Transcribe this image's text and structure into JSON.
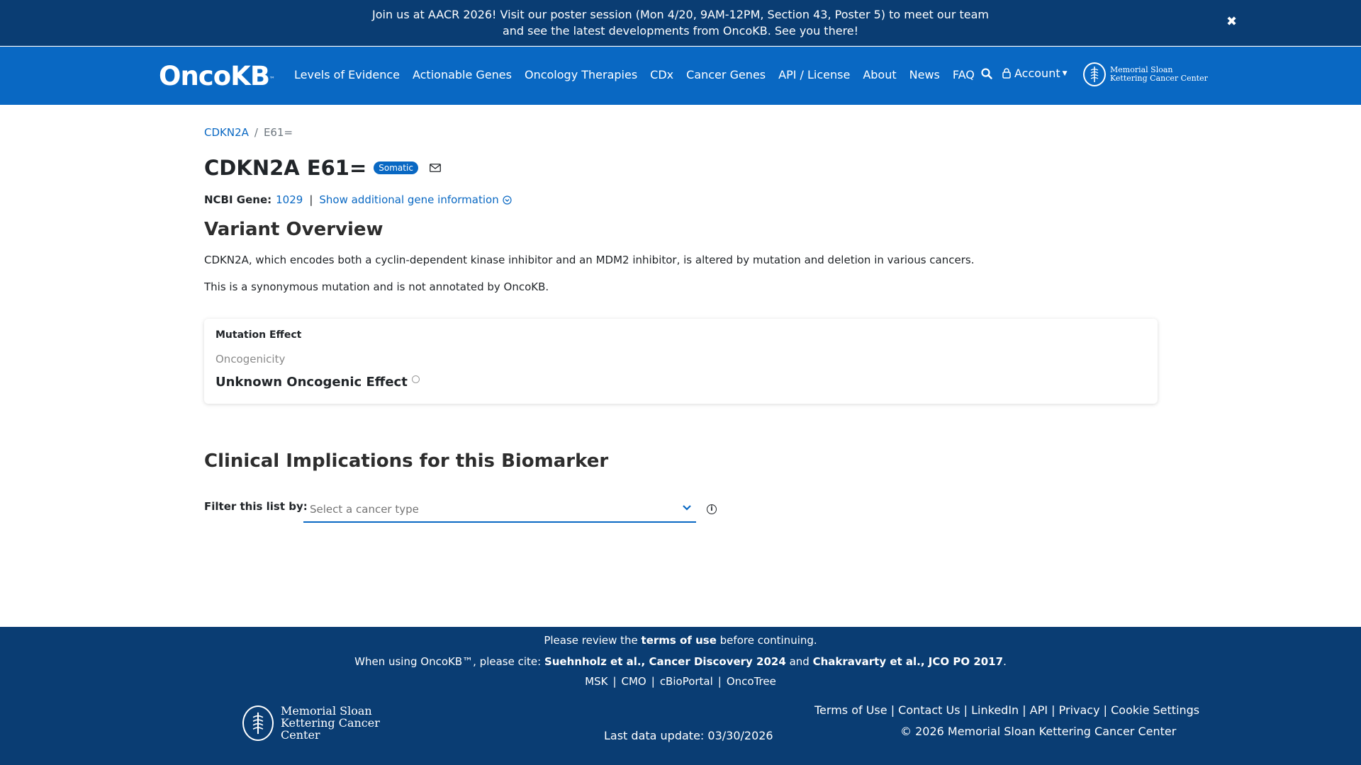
{
  "banner": {
    "text": "Join us at AACR 2026! Visit our poster session (Mon 4/20, 9AM-12PM, Section 43, Poster 5) to meet our team and see the latest developments from OncoKB. See you there!",
    "close": "✖"
  },
  "nav": {
    "logo": "OncoKB",
    "logo_tm": "™",
    "links": [
      "Levels of Evidence",
      "Actionable Genes",
      "Oncology Therapies",
      "CDx",
      "Cancer Genes",
      "API / License",
      "About",
      "News",
      "FAQ"
    ],
    "account": "Account",
    "msk_logo": "Memorial Sloan Kettering Cancer Center"
  },
  "breadcrumb": {
    "gene": "CDKN2A",
    "variant": "E61="
  },
  "header": {
    "title": "CDKN2A E61=",
    "badge": "Somatic"
  },
  "gene_info": {
    "label": "NCBI Gene:",
    "id": "1029",
    "toggle": "Show additional gene information"
  },
  "overview": {
    "heading": "Variant Overview",
    "paragraph1": "CDKN2A, which encodes both a cyclin-dependent kinase inhibitor and an MDM2 inhibitor, is altered by mutation and deletion in various cancers.",
    "paragraph2": "This is a synonymous mutation and is not annotated by OncoKB."
  },
  "mutation_card": {
    "title": "Mutation Effect",
    "subtitle": "Oncogenicity",
    "value": "Unknown Oncogenic Effect"
  },
  "clinical": {
    "heading": "Clinical Implications for this Biomarker",
    "filter_label": "Filter this list by:",
    "select_placeholder": "Select a cancer type"
  },
  "footer": {
    "terms_pre": "Please review the ",
    "terms_link": "terms of use",
    "terms_post": " before continuing.",
    "cite_pre": "When using OncoKB™, please cite: ",
    "cite1": "Suehnholz et al., Cancer Discovery 2024",
    "cite_and": " and ",
    "cite2": "Chakravarty et al., JCO PO 2017",
    "cite_end": ".",
    "links": [
      "MSK",
      "CMO",
      "cBioPortal",
      "OncoTree"
    ],
    "msk_logo": "Memorial Sloan Kettering Cancer Center",
    "last_update": "Last data update: 03/30/2026",
    "right_links": [
      "Terms of Use",
      "Contact Us",
      "LinkedIn",
      "API",
      "Privacy",
      "Cookie Settings"
    ],
    "copyright": "© 2026 Memorial Sloan Kettering Cancer Center"
  },
  "colors": {
    "navy": "#0a3d73",
    "primary": "#0968c3"
  }
}
